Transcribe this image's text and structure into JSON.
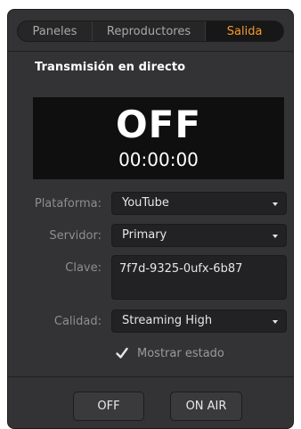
{
  "tabs": [
    {
      "label": "Paneles"
    },
    {
      "label": "Reproductores"
    },
    {
      "label": "Salida"
    }
  ],
  "active_tab": "Salida",
  "section_title": "Transmisión en directo",
  "status": {
    "state": "OFF",
    "timer": "00:00:00"
  },
  "form": {
    "platform": {
      "label": "Plataforma:",
      "value": "YouTube"
    },
    "server": {
      "label": "Servidor:",
      "value": "Primary"
    },
    "key": {
      "label": "Clave:",
      "value": "7f7d-9325-0ufx-6b87"
    },
    "quality": {
      "label": "Calidad:",
      "value": "Streaming High"
    }
  },
  "show_status": {
    "label": "Mostrar estado",
    "checked": true
  },
  "buttons": {
    "off": "OFF",
    "on_air": "ON AIR"
  },
  "colors": {
    "panel_bg": "#333335",
    "accent": "#f59a2b",
    "field_bg": "#222224",
    "status_bg": "#0f0f0f"
  }
}
